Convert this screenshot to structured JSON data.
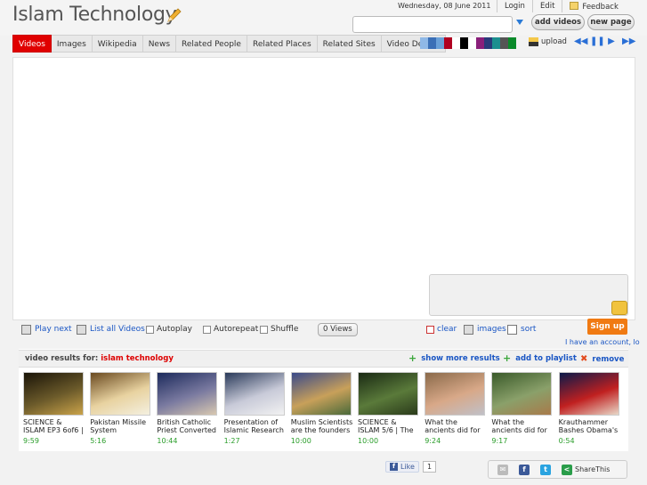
{
  "header": {
    "logo": "Islam Technology",
    "date": "Wednesday, 08 June 2011",
    "links": {
      "login": "Login",
      "edit": "Edit",
      "feedback": "Feedback"
    },
    "search": {
      "value": "",
      "placeholder": ""
    },
    "add_videos": "add videos",
    "new_page": "new page"
  },
  "tabs": [
    "Videos",
    "Images",
    "Wikipedia",
    "News",
    "Related People",
    "Related Places",
    "Related Sites",
    "Video Details"
  ],
  "active_tab": "Videos",
  "theme_colors": [
    "#8fb8e6",
    "#3b6fb6",
    "#6aa0d8",
    "#b00020",
    "#ffffff",
    "#000000",
    "#ffffff",
    "#8a1f7a",
    "#2a3a7a",
    "#1c8f8f",
    "#555555",
    "#0a8a2a"
  ],
  "upload": "upload",
  "player_controls": [
    "rewind-icon",
    "pause-icon",
    "play-icon",
    "fast-forward-icon"
  ],
  "controls": {
    "play_next": "Play next",
    "list_all": "List all Videos",
    "autoplay": "Autoplay",
    "autorepeat": "Autorepeat",
    "shuffle": "Shuffle",
    "views": "0 Views",
    "clear": "clear",
    "images": "images",
    "sort": "sort"
  },
  "signup": {
    "button": "Sign up",
    "account_text": "I have an account, lo"
  },
  "results": {
    "label": "video results for:",
    "query": "islam technology",
    "show_more": "show more results",
    "add_to_playlist": "add to playlist",
    "remove": "remove",
    "videos": [
      {
        "title": "SCIENCE & ISLAM EP3 6of6 |",
        "duration": "9:59",
        "colors": [
          "#1a1408",
          "#6b5a2a",
          "#caa34a"
        ]
      },
      {
        "title": "Pakistan Missile System",
        "duration": "5:16",
        "colors": [
          "#6a4a20",
          "#e8d2a0",
          "#f4f0e0"
        ]
      },
      {
        "title": "British Catholic Priest Converted",
        "duration": "10:44",
        "colors": [
          "#1c2a5c",
          "#7a7aa0",
          "#d8c8b0"
        ]
      },
      {
        "title": "Presentation of Islamic Research",
        "duration": "1:27",
        "colors": [
          "#2a3a5a",
          "#c8cad8",
          "#f2f2f2"
        ]
      },
      {
        "title": "Muslim Scientists are the founders",
        "duration": "10:00",
        "colors": [
          "#3a4a8a",
          "#c8a05a",
          "#4a6a3a"
        ]
      },
      {
        "title": "SCIENCE & ISLAM 5/6 | The",
        "duration": "10:00",
        "colors": [
          "#1a2a14",
          "#5a7a3a",
          "#2a3a1a"
        ]
      },
      {
        "title": "What the ancients did for",
        "duration": "9:24",
        "colors": [
          "#8a6a4a",
          "#d8a888",
          "#c0c0c8"
        ]
      },
      {
        "title": "What the ancients did for",
        "duration": "9:17",
        "colors": [
          "#3a5a2a",
          "#8aa06a",
          "#a87a4a"
        ]
      },
      {
        "title": "Krauthammer Bashes Obama's",
        "duration": "0:54",
        "colors": [
          "#0a1a4a",
          "#c02020",
          "#e8d8c8"
        ]
      }
    ]
  },
  "footer": {
    "like": "Like",
    "like_count": "1",
    "share": "ShareThis"
  }
}
